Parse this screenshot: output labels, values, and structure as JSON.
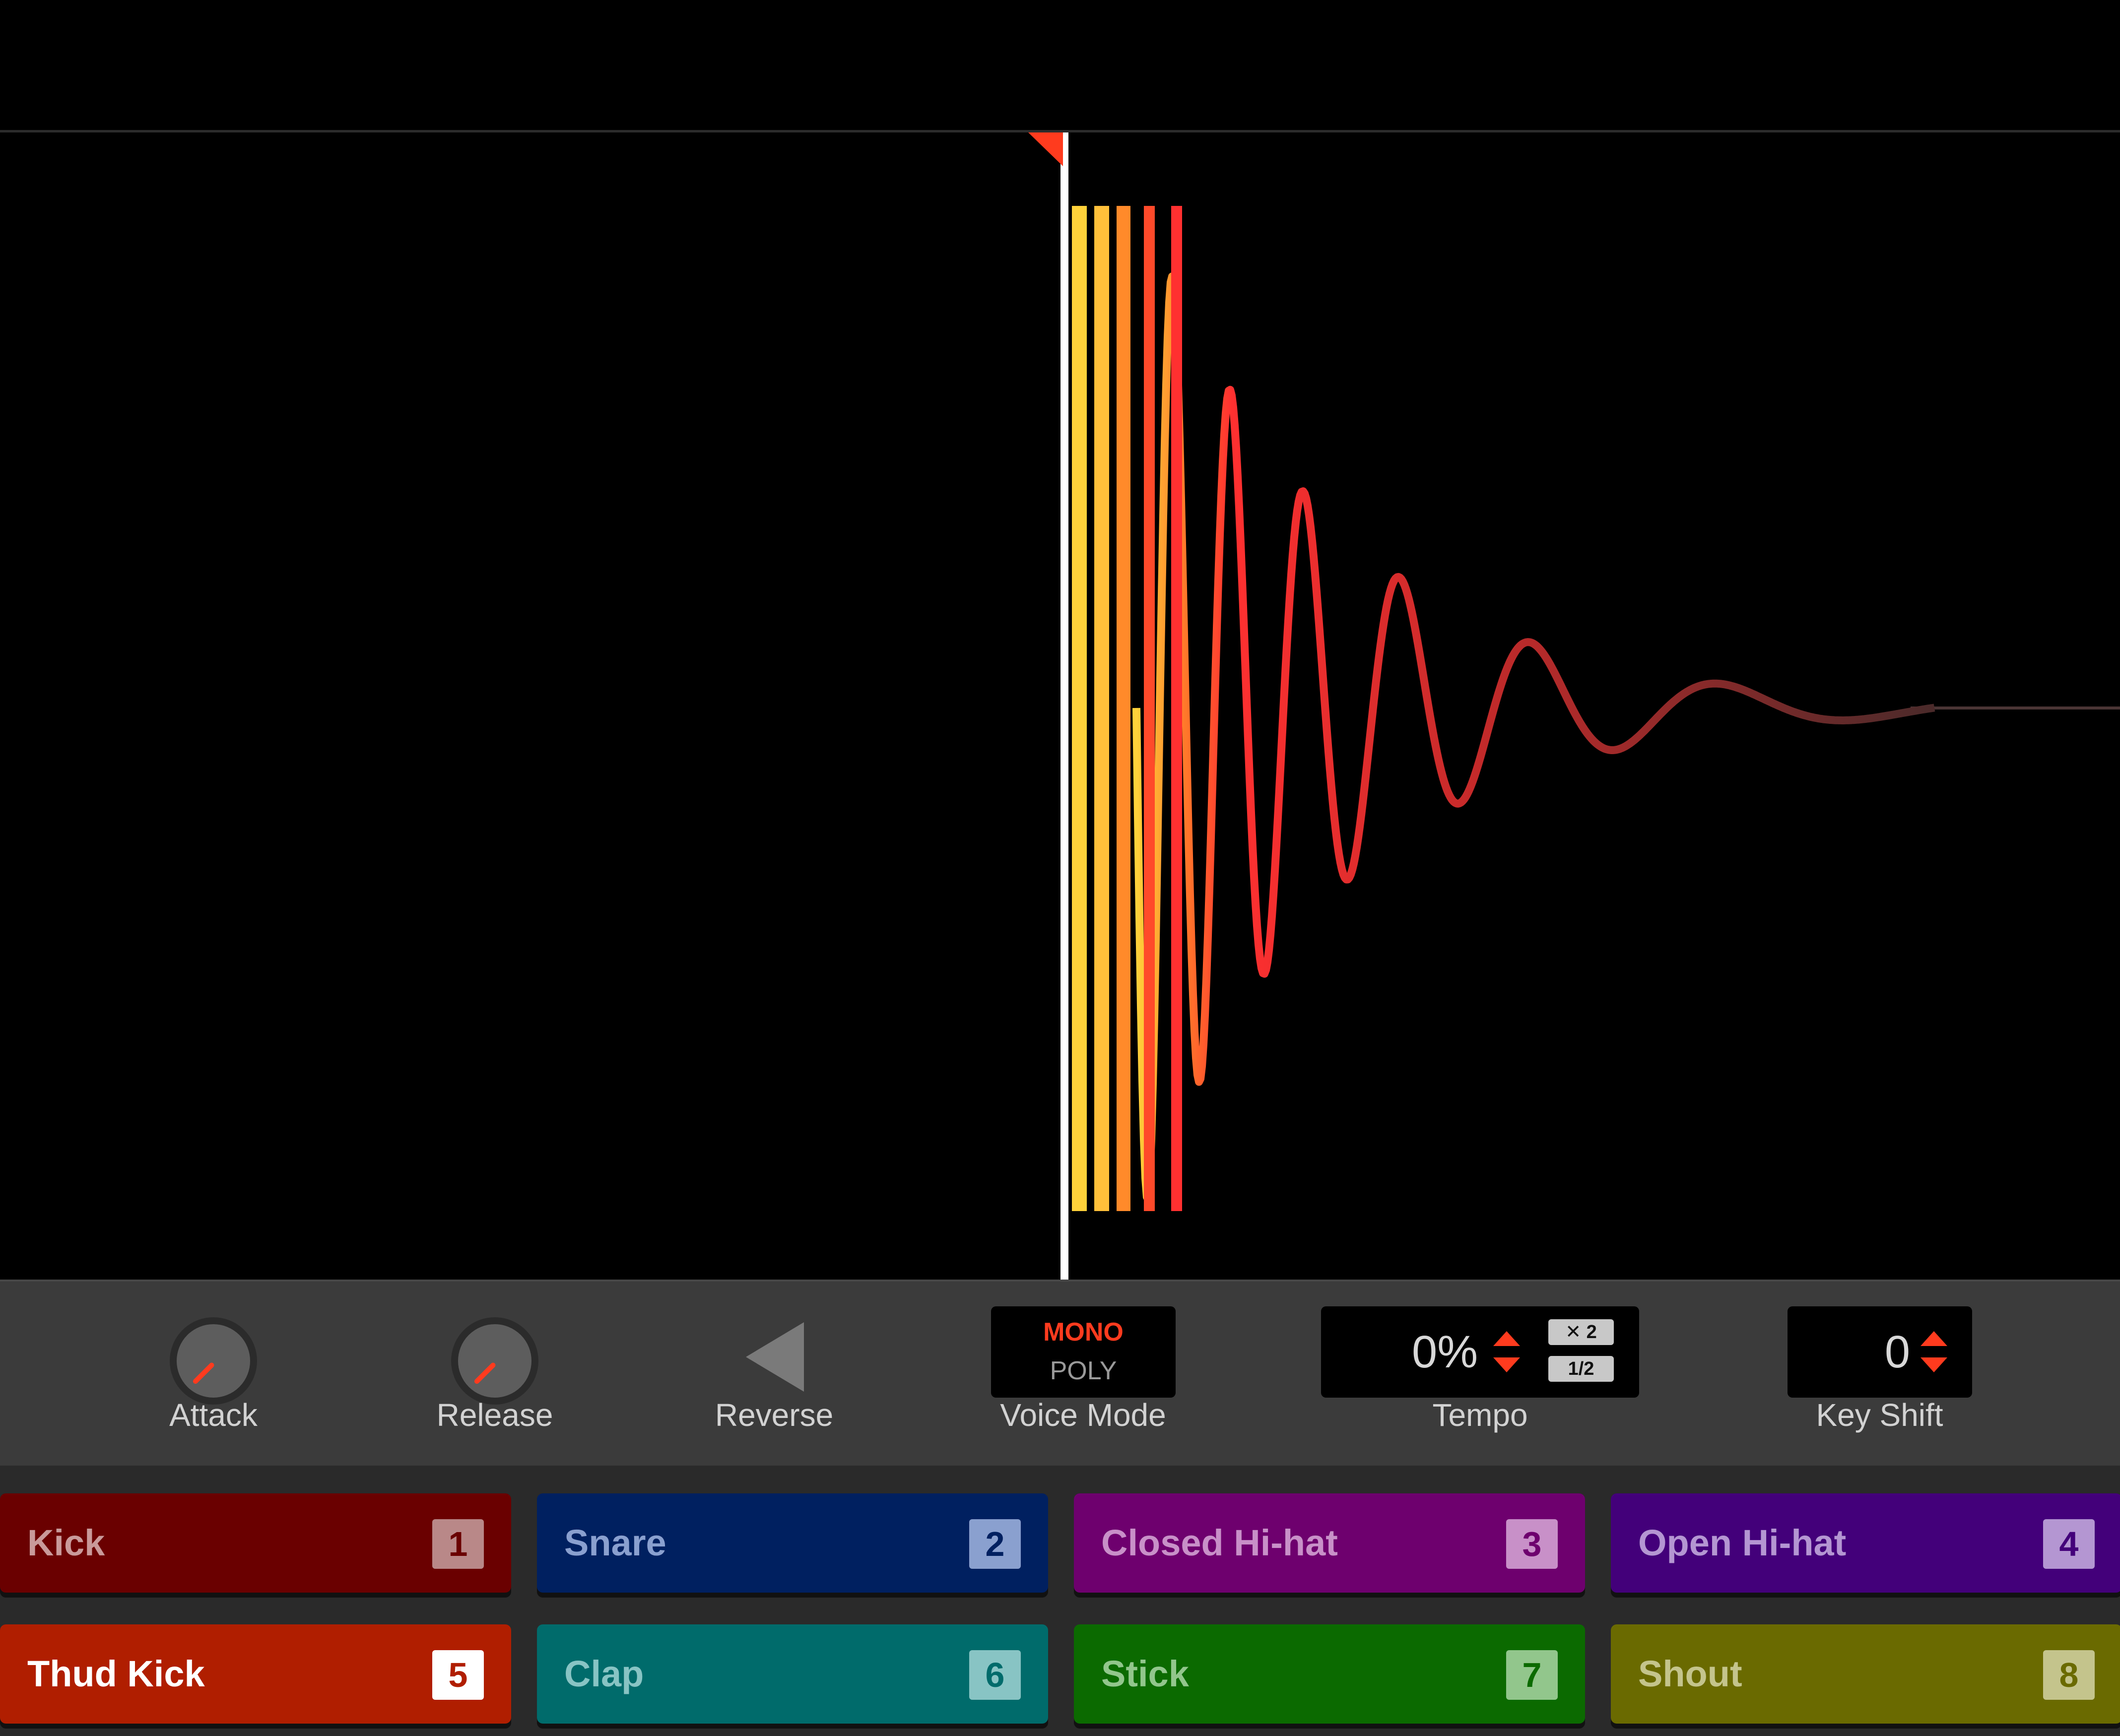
{
  "controls": {
    "attack": {
      "label": "Attack",
      "level": 0.15
    },
    "release": {
      "label": "Release",
      "level": 0.15
    },
    "reverse": {
      "label": "Reverse"
    },
    "voice_mode": {
      "label": "Voice Mode",
      "option_mono": "MONO",
      "option_poly": "POLY",
      "selected": "MONO"
    },
    "tempo": {
      "label": "Tempo",
      "value": "0%",
      "double_label": "✕ 2",
      "half_label": "1/2"
    },
    "key_shift": {
      "label": "Key Shift",
      "value": "0"
    }
  },
  "pads": [
    {
      "name": "Kick",
      "number": "1",
      "color": "#6a0000",
      "text_color": "#c99a9a",
      "badge_bg": "#b98888",
      "badge_text": "#6a0000",
      "active": false
    },
    {
      "name": "Snare",
      "number": "2",
      "color": "#002060",
      "text_color": "#8aa0cf",
      "badge_bg": "#8aa0cf",
      "badge_text": "#002060",
      "active": false
    },
    {
      "name": "Closed Hi-hat",
      "number": "3",
      "color": "#6e006e",
      "text_color": "#c890c8",
      "badge_bg": "#c890c8",
      "badge_text": "#6e006e",
      "active": false
    },
    {
      "name": "Open Hi-hat",
      "number": "4",
      "color": "#43007a",
      "text_color": "#b496d2",
      "badge_bg": "#b496d2",
      "badge_text": "#43007a",
      "active": false
    },
    {
      "name": "Thud Kick",
      "number": "5",
      "color": "#b01e00",
      "text_color": "#ffffff",
      "badge_bg": "#ffffff",
      "badge_text": "#b01e00",
      "active": true
    },
    {
      "name": "Clap",
      "number": "6",
      "color": "#006b6b",
      "text_color": "#88c4c4",
      "badge_bg": "#88c4c4",
      "badge_text": "#006b6b",
      "active": false
    },
    {
      "name": "Stick",
      "number": "7",
      "color": "#0b6a00",
      "text_color": "#92c68c",
      "badge_bg": "#92c68c",
      "badge_text": "#0b6a00",
      "active": false
    },
    {
      "name": "Shout",
      "number": "8",
      "color": "#6a6a00",
      "text_color": "#c4c48c",
      "badge_bg": "#c4c48c",
      "badge_text": "#6a6a00",
      "active": false
    }
  ],
  "colors": {
    "accent": "#ff3b1e",
    "wave_start": "#ffd23a",
    "wave_mid": "#ff3030",
    "wave_tail": "#6b3030",
    "playhead": "#ffffff"
  },
  "icons": {
    "start_marker": "triangle-flag",
    "reverse": "left-triangle"
  }
}
